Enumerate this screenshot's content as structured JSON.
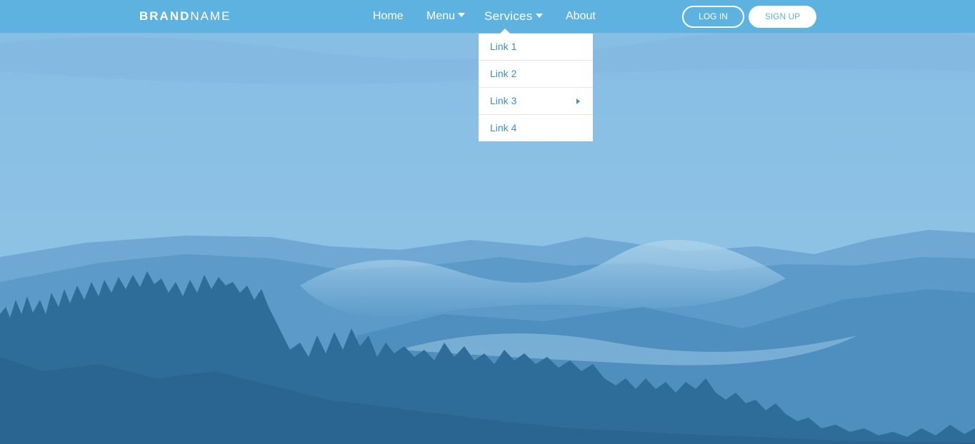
{
  "navbar": {
    "brand_bold": "BRAND",
    "brand_light": "NAME",
    "links": {
      "home": "Home",
      "menu": "Menu",
      "services": "Services",
      "about": "About"
    },
    "login_label": "LOG IN",
    "signup_label": "SIGN UP"
  },
  "services_dropdown": {
    "items": [
      "Link 1",
      "Link 2",
      "Link 3",
      "Link 4"
    ]
  },
  "colors": {
    "navbar": "#5eb2e0",
    "sky": "#8cc2e6",
    "link_text": "#3e8fc4"
  },
  "icons": {
    "menu_caret": "caret-down-icon",
    "services_caret": "caret-down-icon",
    "link3_submenu": "caret-right-icon"
  }
}
